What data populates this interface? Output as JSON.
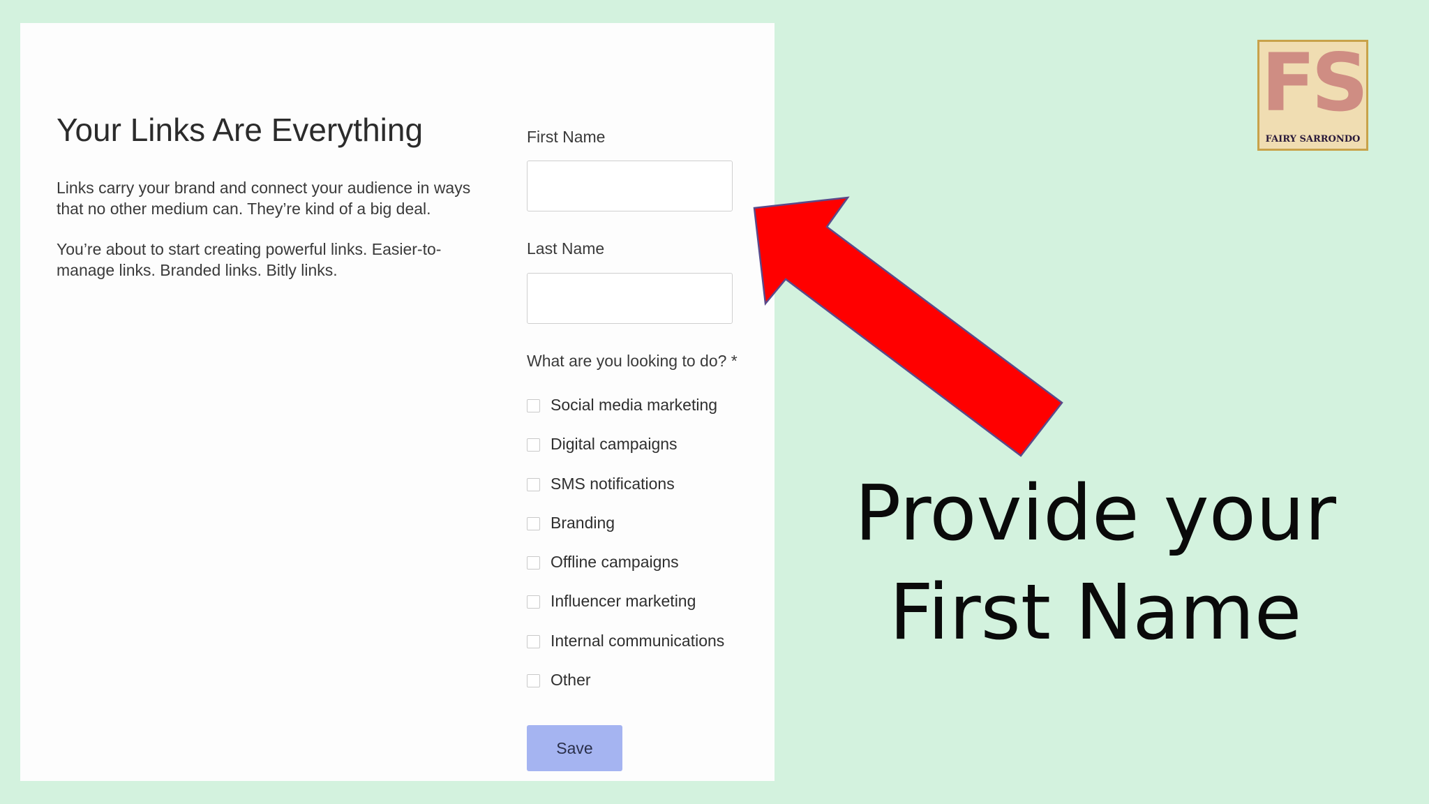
{
  "intro": {
    "title": "Your Links Are Everything",
    "paragraph1": "Links carry your brand and connect your audience in ways that no other medium can. They’re kind of a big deal.",
    "paragraph2": "You’re about to start creating powerful links. Easier-to-manage links. Branded links. Bitly links."
  },
  "form": {
    "first_name_label": "First Name",
    "first_name_value": "",
    "last_name_label": "Last Name",
    "last_name_value": "",
    "question_label": "What are you looking to do? *",
    "options": [
      "Social media marketing",
      "Digital campaigns",
      "SMS notifications",
      "Branding",
      "Offline campaigns",
      "Influencer marketing",
      "Internal communications",
      "Other"
    ],
    "save_label": "Save"
  },
  "annotation": {
    "line1": "Provide your",
    "line2": "First Name",
    "arrow_color": "#ff0000"
  },
  "logo": {
    "letters": "FS",
    "name": "FAIRY SARRONDO"
  },
  "colors": {
    "background": "#d3f2de",
    "save_button": "#a5b4f1"
  }
}
